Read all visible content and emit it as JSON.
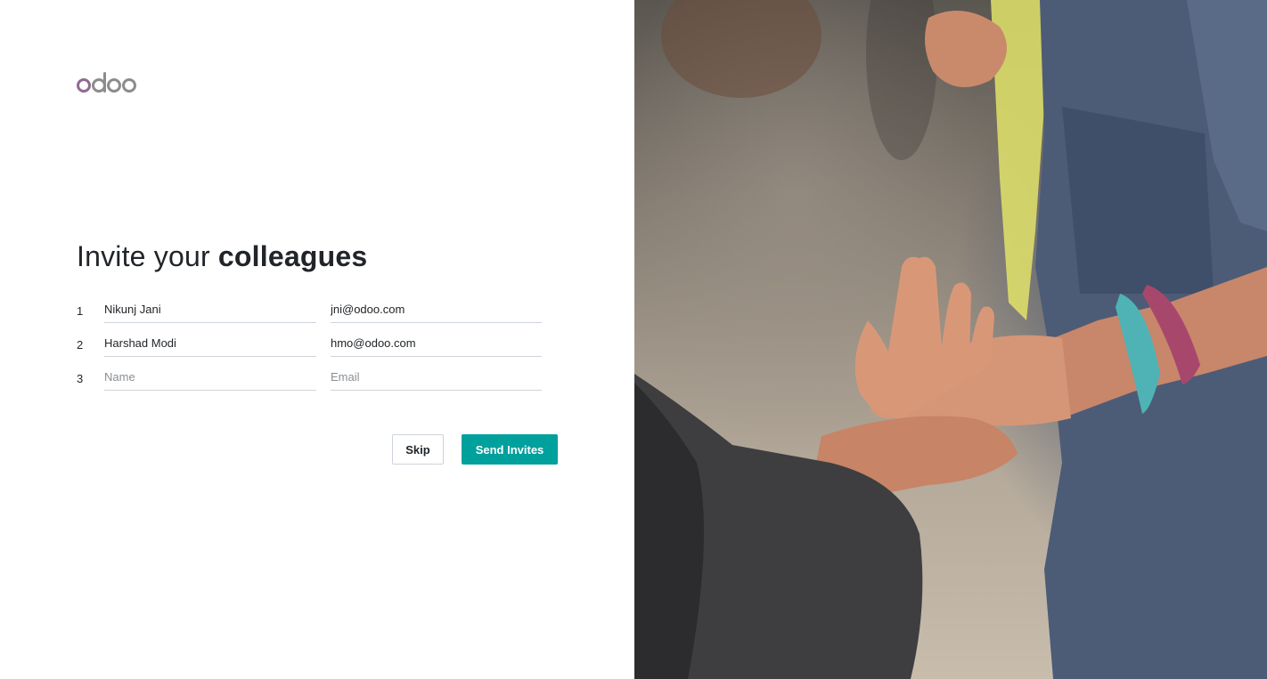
{
  "brand": {
    "logo_text": "odoo"
  },
  "heading": {
    "prefix": "Invite your ",
    "emphasis": "colleagues"
  },
  "invites": [
    {
      "number": "1",
      "name": "Nikunj Jani",
      "email": "jni@odoo.com",
      "name_placeholder": "Name",
      "email_placeholder": "Email"
    },
    {
      "number": "2",
      "name": "Harshad Modi",
      "email": "hmo@odoo.com",
      "name_placeholder": "Name",
      "email_placeholder": "Email"
    },
    {
      "number": "3",
      "name": "",
      "email": "",
      "name_placeholder": "Name",
      "email_placeholder": "Email"
    }
  ],
  "actions": {
    "skip_label": "Skip",
    "send_label": "Send Invites"
  },
  "colors": {
    "primary": "#00a09d",
    "logo_accent": "#8f6b8f",
    "logo_gray": "#8c8c8c"
  },
  "photo": {
    "subject": "hands-reaching-photo"
  }
}
